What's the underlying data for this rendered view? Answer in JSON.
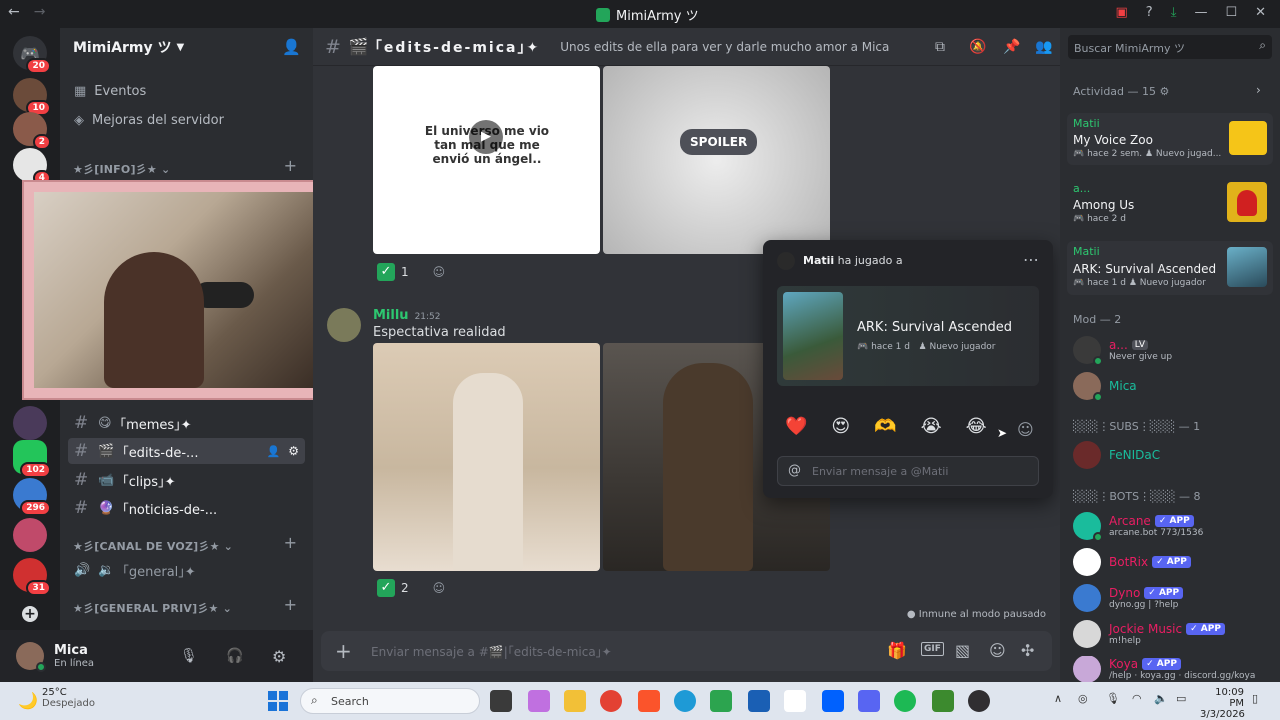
{
  "window": {
    "title": "MimiArmy ツ",
    "back": "←",
    "forward": "→"
  },
  "server": {
    "name": "MimiArmy ツ",
    "events": "Eventos",
    "boosts": "Mejoras del servidor",
    "cat_info": "★彡[INFO]彡★",
    "cat_voice": "★彡[CANAL DE VOZ]彡★",
    "cat_priv": "★彡[GENERAL PRIV]彡★",
    "ch_memes": "｢memes｣✦",
    "ch_edits": "｢edits-de-...",
    "ch_clips": "｢clips｣✦",
    "ch_news": "｢noticias-de-...",
    "ch_voice": "｢general｣✦"
  },
  "guilds": [
    {
      "badge": "20"
    },
    {
      "badge": "10"
    },
    {
      "badge": "2"
    },
    {
      "badge": "4"
    },
    {
      "badge": "102"
    },
    {
      "badge": "296"
    },
    {
      "badge": "31"
    }
  ],
  "user": {
    "name": "Mica",
    "status": "En línea"
  },
  "channel": {
    "name": "｢edits-de-mica｣✦",
    "topic": "Unos edits de ella para ver y darle mucho amor a Mica",
    "composer_placeholder": "Enviar mensaje a #🎬|｢edits-de-mica｣✦",
    "paused_notice": "Inmune al modo pausado"
  },
  "messages": {
    "video_caption": "El universo me vio tan mal que me envió un ángel..",
    "spoiler": "SPOILER",
    "reaction1_count": "1",
    "author": "Millu",
    "time": "21:52",
    "text": "Espectativa realidad",
    "reaction2_count": "2"
  },
  "popup": {
    "user": "Matii",
    "action": "ha jugado a",
    "game": "ARK: Survival Ascended",
    "when": "hace 1 d",
    "tag": "Nuevo jugador",
    "message_placeholder": "Enviar mensaje a @Matii",
    "emojis": [
      "❤️",
      "😍",
      "🫶",
      "😭",
      "😂"
    ]
  },
  "members": {
    "search_placeholder": "Buscar MimiArmy ツ",
    "activity_title": "Actividad — 15",
    "activities": [
      {
        "user": "Matii",
        "game": "My Voice Zoo",
        "when": "hace 2 sem.",
        "tag": "Nuevo jugad..."
      },
      {
        "user": "a...",
        "game": "Among Us",
        "when": "hace 2 d",
        "tag": ""
      },
      {
        "user": "Matii",
        "game": "ARK: Survival Ascended",
        "when": "hace 1 d",
        "tag": "Nuevo jugador"
      }
    ],
    "mod_title": "Mod — 2",
    "mod1_name": "a...",
    "mod1_badge": "LV",
    "mod1_status": "Never give up",
    "mod2_name": "Mica",
    "subs_title": "░░░⋮SUBS⋮░░░ — 1",
    "sub1_name": "FeNIDaC",
    "bots_title": "░░░⋮BOTS⋮░░░ — 8",
    "app_tag": "✓ APP",
    "bots": [
      {
        "name": "Arcane",
        "status": "arcane.bot 773/1536",
        "color": "#e91e63"
      },
      {
        "name": "BotRix",
        "status": "",
        "color": "#e91e63"
      },
      {
        "name": "Dyno",
        "status": "dyno.gg | ?help",
        "color": "#e91e63"
      },
      {
        "name": "Jockie Music",
        "status": "m!help",
        "color": "#e91e63"
      },
      {
        "name": "Koya",
        "status": "/help · koya.gg · discord.gg/koya",
        "color": "#e91e63"
      }
    ]
  },
  "taskbar": {
    "weather_temp": "25°C",
    "weather_desc": "Despejado",
    "search": "Search",
    "time": "10:09 PM",
    "date": "3/3/2026"
  },
  "colors": {
    "accent": "#5865f2",
    "online": "#23a55a",
    "mention": "#f23f43",
    "author_green": "#2dc770",
    "bot_pink": "#e91e63"
  }
}
